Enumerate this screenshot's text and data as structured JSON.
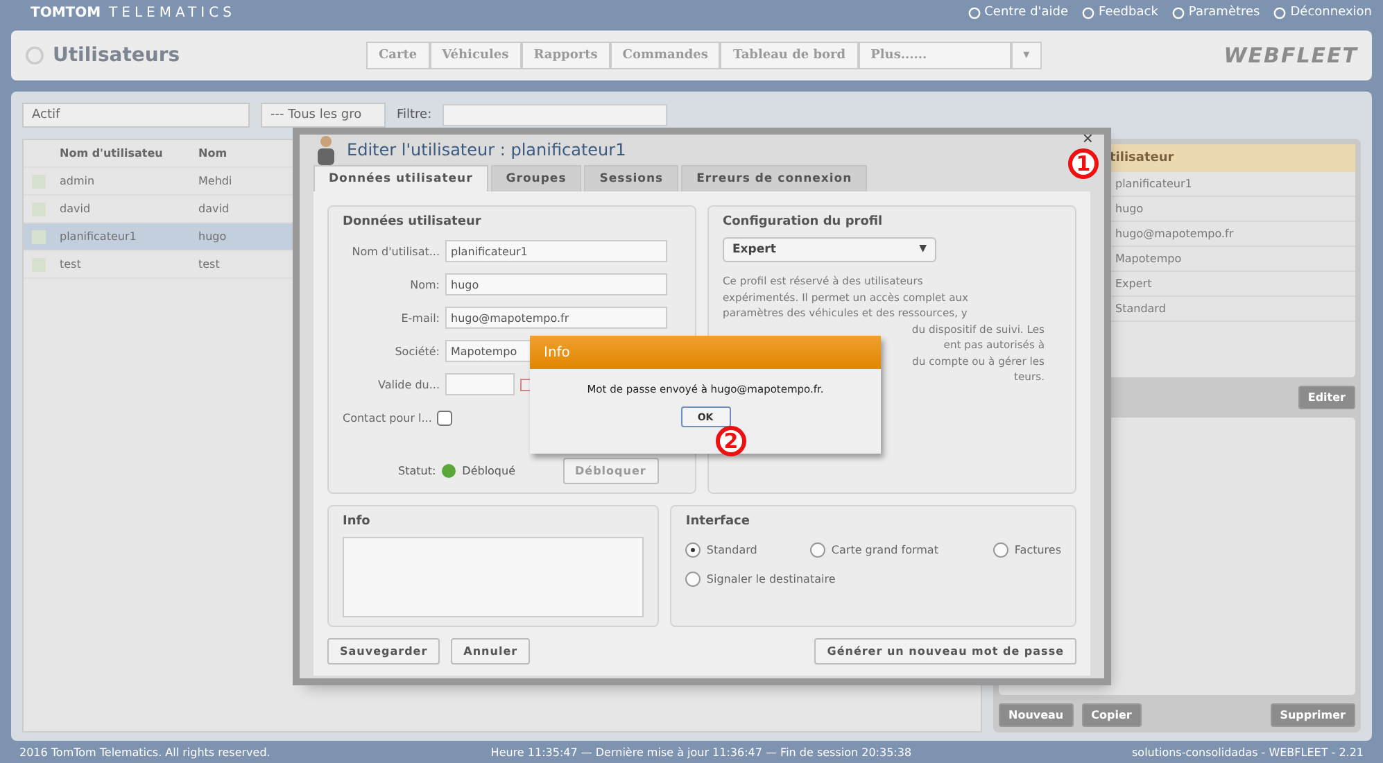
{
  "header": {
    "logo_main": "TOMTOM",
    "logo_sub": "TELEMATICS",
    "links": [
      {
        "label": "Centre d'aide"
      },
      {
        "label": "Feedback"
      },
      {
        "label": "Paramètres"
      },
      {
        "label": "Déconnexion"
      }
    ]
  },
  "page": {
    "title": "Utilisateurs",
    "nav": [
      "Carte",
      "Véhicules",
      "Rapports",
      "Commandes",
      "Tableau de bord"
    ],
    "nav_more": "Plus......",
    "nav_more_caret": "▾",
    "brand": "WEBFLEET"
  },
  "filters": {
    "status": "Actif",
    "group": "--- Tous les gro",
    "filter_label": "Filtre:"
  },
  "table": {
    "columns": [
      "Nom d'utilisateu",
      "Nom"
    ],
    "rows": [
      {
        "cells": [
          "admin",
          "Mehdi"
        ],
        "selected": false
      },
      {
        "cells": [
          "david",
          "david"
        ],
        "selected": false
      },
      {
        "cells": [
          "planificateur1",
          "hugo"
        ],
        "selected": true
      },
      {
        "cells": [
          "test",
          "test"
        ],
        "selected": false
      }
    ]
  },
  "detail": {
    "title": "tilisateur",
    "values": [
      "planificateur1",
      "hugo",
      "hugo@mapotempo.fr",
      "Mapotempo",
      "Expert",
      "Standard"
    ],
    "edit": "Editer",
    "buttons": [
      "Nouveau",
      "Copier",
      "Supprimer"
    ]
  },
  "footer": {
    "copyright": "2016 TomTom Telematics. All rights reserved.",
    "session": "Heure 11:35:47 — Dernière mise à jour 11:36:47 — Fin de session 20:35:38",
    "version": "solutions-consolidadas - WEBFLEET - 2.21"
  },
  "dialog": {
    "title": "Editer l'utilisateur : planificateur1",
    "close": "×",
    "tabs": [
      {
        "label": "Données utilisateur",
        "selected": true
      },
      {
        "label": "Groupes",
        "selected": false
      },
      {
        "label": "Sessions",
        "selected": false
      },
      {
        "label": "Erreurs de connexion",
        "selected": false
      }
    ],
    "user_data": {
      "legend": "Données utilisateur",
      "fields": [
        {
          "label": "Nom d'utilisat...",
          "value": "planificateur1"
        },
        {
          "label": "Nom:",
          "value": "hugo"
        },
        {
          "label": "E-mail:",
          "value": "hugo@mapotempo.fr"
        },
        {
          "label": "Société:",
          "value": "Mapotempo"
        }
      ],
      "valid_label": "Valide du...",
      "contact_label": "Contact pour l...",
      "contact_checked": false,
      "status_label": "Statut:",
      "status_value": "Débloqué",
      "unlock": "Débloquer",
      "unlock_disabled": true
    },
    "profile": {
      "legend": "Configuration du profil",
      "value": "Expert",
      "caret": "▼",
      "lines": [
        {
          "text": "Ce profil est réservé à des utilisateurs",
          "partial": false
        },
        {
          "text": "expérimentés. Il permet un accès complet aux",
          "partial": false
        },
        {
          "text": "paramètres des véhicules et des ressources, y",
          "partial": false
        },
        {
          "text": "du dispositif de suivi. Les",
          "partial": true
        },
        {
          "text": "ent pas autorisés à",
          "partial": true
        },
        {
          "text": "du compte ou à gérer les",
          "partial": true
        },
        {
          "text": "teurs.",
          "partial": true
        }
      ]
    },
    "info": {
      "legend": "Info"
    },
    "interface": {
      "legend": "Interface",
      "options": [
        {
          "label": "Standard",
          "selected": true
        },
        {
          "label": "Carte grand format",
          "selected": false
        },
        {
          "label": "Factures",
          "selected": false
        },
        {
          "label": "Signaler le destinataire",
          "selected": false
        }
      ]
    },
    "buttons": [
      "Sauvegarder",
      "Annuler"
    ],
    "generate": "Générer un nouveau mot de passe"
  },
  "popup": {
    "title": "Info",
    "message": "Mot de passe envoyé à hugo@mapotempo.fr.",
    "ok": "OK"
  },
  "markers": [
    "1",
    "2"
  ]
}
